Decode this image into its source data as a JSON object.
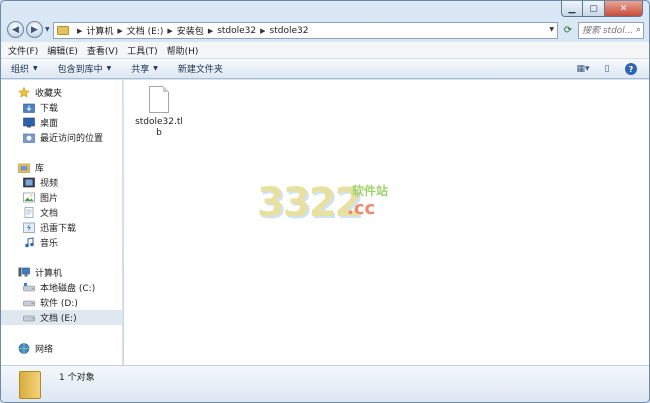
{
  "window": {
    "controls": {
      "minimize": "▁",
      "maximize": "▢",
      "close": "✕"
    }
  },
  "address": {
    "crumbs": [
      "计算机",
      "文档 (E:)",
      "安装包",
      "stdole32",
      "stdole32"
    ]
  },
  "search": {
    "placeholder": "搜索 stdol..."
  },
  "menu": [
    "文件(F)",
    "编辑(E)",
    "查看(V)",
    "工具(T)",
    "帮助(H)"
  ],
  "toolbar": {
    "organize": "组织",
    "include_in_library": "包含到库中",
    "share": "共享",
    "new_folder": "新建文件夹"
  },
  "nav": {
    "favorites": "收藏夹",
    "favorites_items": [
      "下载",
      "桌面",
      "最近访问的位置"
    ],
    "libraries": "库",
    "library_items": [
      "视频",
      "图片",
      "文档",
      "迅雷下载",
      "音乐"
    ],
    "computer": "计算机",
    "drives": [
      "本地磁盘 (C:)",
      "软件 (D:)",
      "文档 (E:)"
    ],
    "network": "网络"
  },
  "files": [
    {
      "name": "stdole32.tlb"
    }
  ],
  "watermark": {
    "num": "3322",
    "cn": "软件站",
    "cc": ".cc"
  },
  "details": {
    "count": "1 个对象"
  },
  "colors": {
    "accent": "#2d65b0",
    "selected": "#dfe7f0",
    "folder": "#e4c35f"
  }
}
